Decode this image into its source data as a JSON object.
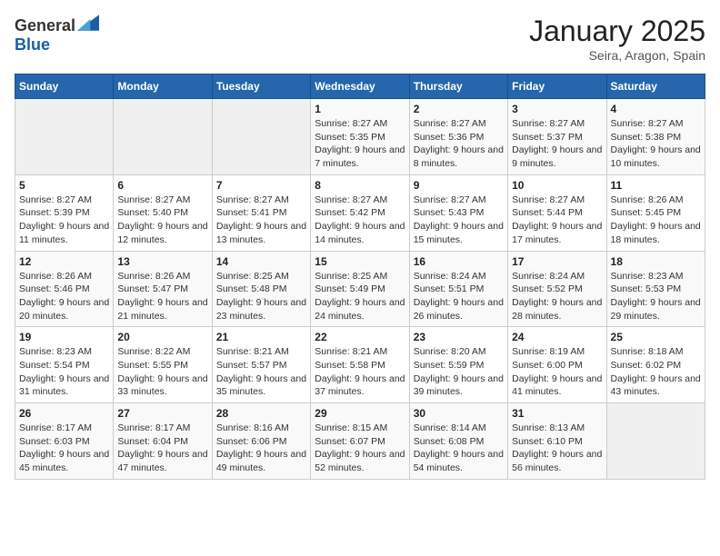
{
  "header": {
    "logo_general": "General",
    "logo_blue": "Blue",
    "title": "January 2025",
    "subtitle": "Seira, Aragon, Spain"
  },
  "weekdays": [
    "Sunday",
    "Monday",
    "Tuesday",
    "Wednesday",
    "Thursday",
    "Friday",
    "Saturday"
  ],
  "weeks": [
    [
      {
        "day": "",
        "sunrise": "",
        "sunset": "",
        "daylight": ""
      },
      {
        "day": "",
        "sunrise": "",
        "sunset": "",
        "daylight": ""
      },
      {
        "day": "",
        "sunrise": "",
        "sunset": "",
        "daylight": ""
      },
      {
        "day": "1",
        "sunrise": "Sunrise: 8:27 AM",
        "sunset": "Sunset: 5:35 PM",
        "daylight": "Daylight: 9 hours and 7 minutes."
      },
      {
        "day": "2",
        "sunrise": "Sunrise: 8:27 AM",
        "sunset": "Sunset: 5:36 PM",
        "daylight": "Daylight: 9 hours and 8 minutes."
      },
      {
        "day": "3",
        "sunrise": "Sunrise: 8:27 AM",
        "sunset": "Sunset: 5:37 PM",
        "daylight": "Daylight: 9 hours and 9 minutes."
      },
      {
        "day": "4",
        "sunrise": "Sunrise: 8:27 AM",
        "sunset": "Sunset: 5:38 PM",
        "daylight": "Daylight: 9 hours and 10 minutes."
      }
    ],
    [
      {
        "day": "5",
        "sunrise": "Sunrise: 8:27 AM",
        "sunset": "Sunset: 5:39 PM",
        "daylight": "Daylight: 9 hours and 11 minutes."
      },
      {
        "day": "6",
        "sunrise": "Sunrise: 8:27 AM",
        "sunset": "Sunset: 5:40 PM",
        "daylight": "Daylight: 9 hours and 12 minutes."
      },
      {
        "day": "7",
        "sunrise": "Sunrise: 8:27 AM",
        "sunset": "Sunset: 5:41 PM",
        "daylight": "Daylight: 9 hours and 13 minutes."
      },
      {
        "day": "8",
        "sunrise": "Sunrise: 8:27 AM",
        "sunset": "Sunset: 5:42 PM",
        "daylight": "Daylight: 9 hours and 14 minutes."
      },
      {
        "day": "9",
        "sunrise": "Sunrise: 8:27 AM",
        "sunset": "Sunset: 5:43 PM",
        "daylight": "Daylight: 9 hours and 15 minutes."
      },
      {
        "day": "10",
        "sunrise": "Sunrise: 8:27 AM",
        "sunset": "Sunset: 5:44 PM",
        "daylight": "Daylight: 9 hours and 17 minutes."
      },
      {
        "day": "11",
        "sunrise": "Sunrise: 8:26 AM",
        "sunset": "Sunset: 5:45 PM",
        "daylight": "Daylight: 9 hours and 18 minutes."
      }
    ],
    [
      {
        "day": "12",
        "sunrise": "Sunrise: 8:26 AM",
        "sunset": "Sunset: 5:46 PM",
        "daylight": "Daylight: 9 hours and 20 minutes."
      },
      {
        "day": "13",
        "sunrise": "Sunrise: 8:26 AM",
        "sunset": "Sunset: 5:47 PM",
        "daylight": "Daylight: 9 hours and 21 minutes."
      },
      {
        "day": "14",
        "sunrise": "Sunrise: 8:25 AM",
        "sunset": "Sunset: 5:48 PM",
        "daylight": "Daylight: 9 hours and 23 minutes."
      },
      {
        "day": "15",
        "sunrise": "Sunrise: 8:25 AM",
        "sunset": "Sunset: 5:49 PM",
        "daylight": "Daylight: 9 hours and 24 minutes."
      },
      {
        "day": "16",
        "sunrise": "Sunrise: 8:24 AM",
        "sunset": "Sunset: 5:51 PM",
        "daylight": "Daylight: 9 hours and 26 minutes."
      },
      {
        "day": "17",
        "sunrise": "Sunrise: 8:24 AM",
        "sunset": "Sunset: 5:52 PM",
        "daylight": "Daylight: 9 hours and 28 minutes."
      },
      {
        "day": "18",
        "sunrise": "Sunrise: 8:23 AM",
        "sunset": "Sunset: 5:53 PM",
        "daylight": "Daylight: 9 hours and 29 minutes."
      }
    ],
    [
      {
        "day": "19",
        "sunrise": "Sunrise: 8:23 AM",
        "sunset": "Sunset: 5:54 PM",
        "daylight": "Daylight: 9 hours and 31 minutes."
      },
      {
        "day": "20",
        "sunrise": "Sunrise: 8:22 AM",
        "sunset": "Sunset: 5:55 PM",
        "daylight": "Daylight: 9 hours and 33 minutes."
      },
      {
        "day": "21",
        "sunrise": "Sunrise: 8:21 AM",
        "sunset": "Sunset: 5:57 PM",
        "daylight": "Daylight: 9 hours and 35 minutes."
      },
      {
        "day": "22",
        "sunrise": "Sunrise: 8:21 AM",
        "sunset": "Sunset: 5:58 PM",
        "daylight": "Daylight: 9 hours and 37 minutes."
      },
      {
        "day": "23",
        "sunrise": "Sunrise: 8:20 AM",
        "sunset": "Sunset: 5:59 PM",
        "daylight": "Daylight: 9 hours and 39 minutes."
      },
      {
        "day": "24",
        "sunrise": "Sunrise: 8:19 AM",
        "sunset": "Sunset: 6:00 PM",
        "daylight": "Daylight: 9 hours and 41 minutes."
      },
      {
        "day": "25",
        "sunrise": "Sunrise: 8:18 AM",
        "sunset": "Sunset: 6:02 PM",
        "daylight": "Daylight: 9 hours and 43 minutes."
      }
    ],
    [
      {
        "day": "26",
        "sunrise": "Sunrise: 8:17 AM",
        "sunset": "Sunset: 6:03 PM",
        "daylight": "Daylight: 9 hours and 45 minutes."
      },
      {
        "day": "27",
        "sunrise": "Sunrise: 8:17 AM",
        "sunset": "Sunset: 6:04 PM",
        "daylight": "Daylight: 9 hours and 47 minutes."
      },
      {
        "day": "28",
        "sunrise": "Sunrise: 8:16 AM",
        "sunset": "Sunset: 6:06 PM",
        "daylight": "Daylight: 9 hours and 49 minutes."
      },
      {
        "day": "29",
        "sunrise": "Sunrise: 8:15 AM",
        "sunset": "Sunset: 6:07 PM",
        "daylight": "Daylight: 9 hours and 52 minutes."
      },
      {
        "day": "30",
        "sunrise": "Sunrise: 8:14 AM",
        "sunset": "Sunset: 6:08 PM",
        "daylight": "Daylight: 9 hours and 54 minutes."
      },
      {
        "day": "31",
        "sunrise": "Sunrise: 8:13 AM",
        "sunset": "Sunset: 6:10 PM",
        "daylight": "Daylight: 9 hours and 56 minutes."
      },
      {
        "day": "",
        "sunrise": "",
        "sunset": "",
        "daylight": ""
      }
    ]
  ]
}
